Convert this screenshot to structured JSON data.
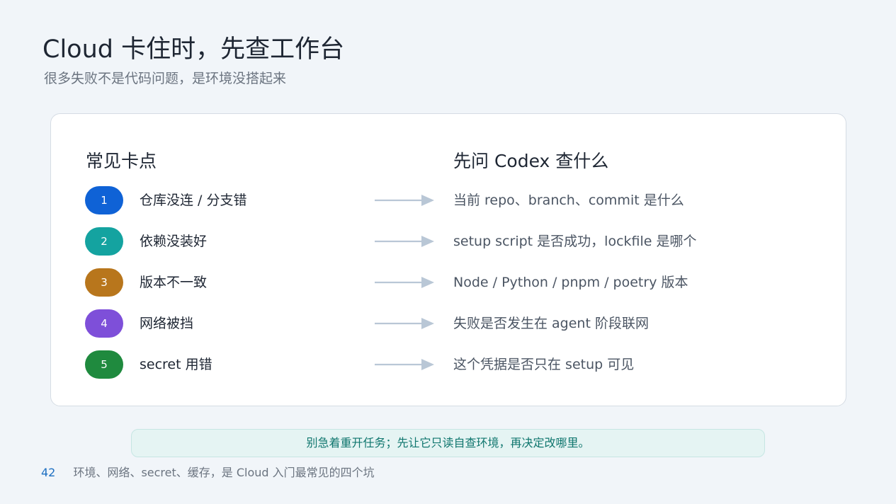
{
  "slide": {
    "title": "Cloud 卡住时，先查工作台",
    "subtitle": "很多失败不是代码问题，是环境没搭起来"
  },
  "table": {
    "left_heading": "常见卡点",
    "right_heading": "先问 Codex 查什么",
    "rows": [
      {
        "number": "1",
        "issue": "仓库没连 / 分支错",
        "question": "当前 repo、branch、commit 是什么",
        "color": "#0f62d6"
      },
      {
        "number": "2",
        "issue": "依赖没装好",
        "question": "setup script 是否成功，lockfile 是哪个",
        "color": "#14a3a0"
      },
      {
        "number": "3",
        "issue": "版本不一致",
        "question": "Node / Python / pnpm / poetry 版本",
        "color": "#b8761c"
      },
      {
        "number": "4",
        "issue": "网络被挡",
        "question": "失败是否发生在 agent 阶段联网",
        "color": "#7e4fd9"
      },
      {
        "number": "5",
        "issue": "secret 用错",
        "question": "这个凭据是否只在 setup 可见",
        "color": "#1f8a3e"
      }
    ]
  },
  "tip": "别急着重开任务；先让它只读自查环境，再决定改哪里。",
  "footer": {
    "page_number": "42",
    "text": "环境、网络、secret、缓存，是 Cloud 入门最常见的四个坑"
  },
  "colors": {
    "arrow": "#b9c7d6",
    "accent": "#0f766e",
    "page_number": "#1d6fc1"
  },
  "icons": {
    "arrow": "arrow-right-icon"
  }
}
